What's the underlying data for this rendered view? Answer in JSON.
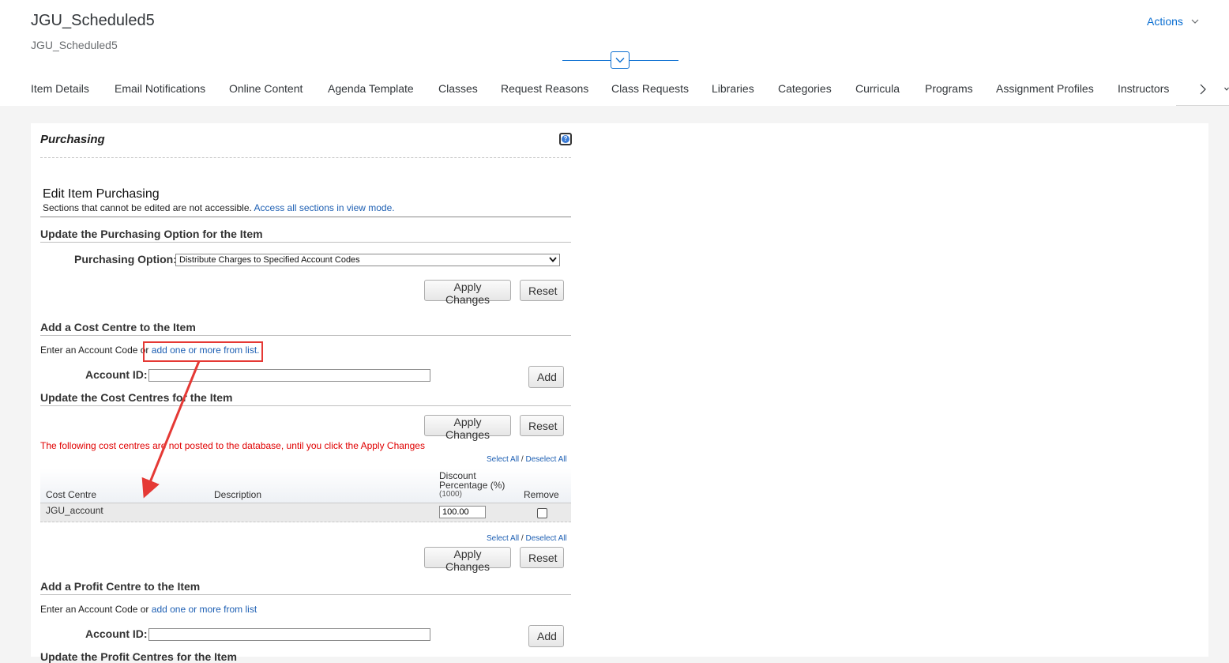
{
  "header": {
    "title": "JGU_Scheduled5",
    "subtitle": "JGU_Scheduled5",
    "actions_label": "Actions"
  },
  "tabs": [
    {
      "label": "Item Details"
    },
    {
      "label": "Email Notifications"
    },
    {
      "label": "Online Content"
    },
    {
      "label": "Agenda Template"
    },
    {
      "label": "Classes"
    },
    {
      "label": "Request Reasons"
    },
    {
      "label": "Class Requests"
    },
    {
      "label": "Libraries"
    },
    {
      "label": "Categories"
    },
    {
      "label": "Curricula"
    },
    {
      "label": "Programs"
    },
    {
      "label": "Assignment Profiles"
    },
    {
      "label": "Instructors"
    }
  ],
  "panel": {
    "title": "Purchasing",
    "edit_heading": "Edit Item Purchasing",
    "edit_note": "Sections that cannot be edited are not accessible.",
    "edit_link": "Access all sections in view mode.",
    "purchasing": {
      "heading": "Update the Purchasing Option for the Item",
      "label": "Purchasing Option:",
      "selected": "Distribute Charges to Specified Account Codes",
      "apply": "Apply Changes",
      "reset": "Reset"
    },
    "add_cost": {
      "heading": "Add a Cost Centre to the Item",
      "prompt": "Enter an Account Code or",
      "link": "add one or more from list.",
      "account_label": "Account ID:",
      "account_value": "",
      "add": "Add"
    },
    "update_cost": {
      "heading": "Update the Cost Centres for the Item",
      "apply": "Apply Changes",
      "reset": "Reset",
      "warning": "The following cost centres are not posted to the database, until you click the Apply Changes",
      "select_all": "Select All",
      "separator": "/",
      "deselect_all": "Deselect All",
      "columns": {
        "cost_centre": "Cost Centre",
        "description": "Description",
        "discount": "Discount",
        "percentage": "Percentage (%)",
        "max": "(1000)",
        "remove": "Remove"
      },
      "rows": [
        {
          "cost_centre": "JGU_account",
          "description": "",
          "discount": "100.00",
          "remove": false
        }
      ],
      "apply2": "Apply Changes",
      "reset2": "Reset"
    },
    "add_profit": {
      "heading": "Add a Profit Centre to the Item",
      "prompt": "Enter an Account Code or",
      "link": "add one or more from list",
      "account_label": "Account ID:",
      "account_value": "",
      "add": "Add"
    },
    "update_profit": {
      "heading": "Update the Profit Centres for the Item"
    }
  },
  "colors": {
    "accent": "#0a6ed1",
    "link": "#1d5fb3",
    "warning": "#e00000",
    "annotation": "#e53935"
  }
}
